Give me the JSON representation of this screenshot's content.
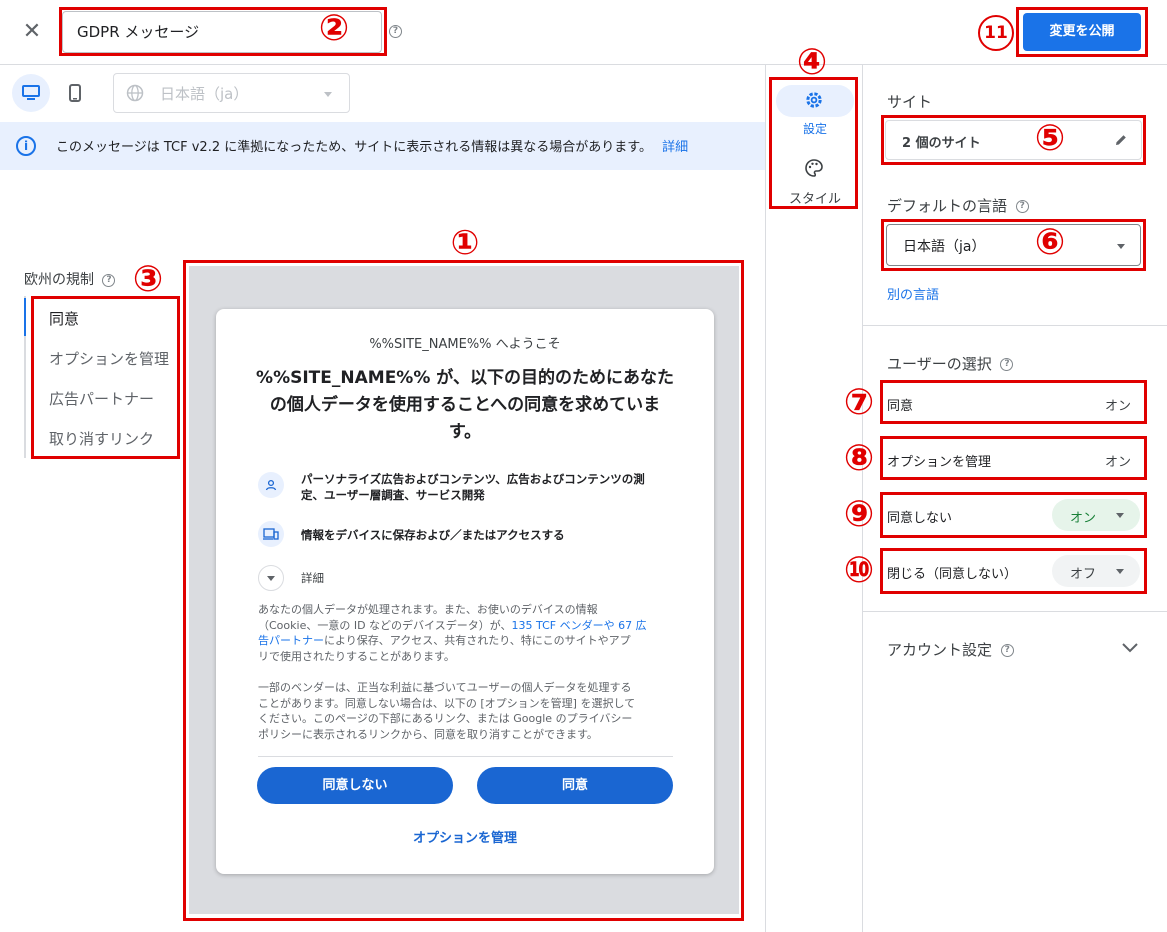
{
  "header": {
    "close_icon": "close-icon",
    "message_name": "GDPR メッセージ",
    "help_glyph": "?",
    "publish_label": "変更を公開"
  },
  "toolbar": {
    "language_placeholder": "日本語（ja）"
  },
  "info_bar": {
    "text": "このメッセージは TCF v2.2 に準拠になったため、サイトに表示される情報は異なる場合があります。",
    "link": "詳細"
  },
  "regulation": {
    "title": "欧州の規制",
    "items": [
      {
        "label": "同意"
      },
      {
        "label": "オプションを管理"
      },
      {
        "label": "広告パートナー"
      },
      {
        "label": "取り消すリンク"
      }
    ]
  },
  "preview": {
    "welcome": "%%SITE_NAME%% へようこそ",
    "headline_l1": "%%SITE_NAME%% が、以下の目的のためにあなた",
    "headline_l2": "の個人データを使用することへの同意を求めていま",
    "headline_l3": "す。",
    "purpose1_l1": "パーソナライズ広告およびコンテンツ、広告およびコンテンツの測",
    "purpose1_l2": "定、ユーザー層調査、サービス開発",
    "purpose2": "情報をデバイスに保存および／またはアクセスする",
    "details": "詳細",
    "para1_l1": "あなたの個人データが処理されます。また、お使いのデバイスの情報",
    "para1_l2_a": "（Cookie、一意の ID などのデバイスデータ）が、",
    "para1_l2_link": "135 TCF ベンダーや 67 広",
    "para1_l3_link": "告パートナー",
    "para1_l3_b": "により保存、アクセス、共有されたり、特にこのサイトやアプ",
    "para1_l4": "リで使用されたりすることがあります。",
    "para2_l1": "一部のベンダーは、正当な利益に基づいてユーザーの個人データを処理する",
    "para2_l2": "ことがあります。同意しない場合は、以下の [オプションを管理] を選択して",
    "para2_l3": "ください。このページの下部にあるリンク、または Google のプライバシー",
    "para2_l4": "ポリシーに表示されるリンクから、同意を取り消すことができます。",
    "decline_button": "同意しない",
    "accept_button": "同意",
    "manage_link": "オプションを管理"
  },
  "rail": {
    "settings_label": "設定",
    "style_label": "スタイル"
  },
  "right_panel": {
    "site_title": "サイト",
    "site_value": "2 個のサイト",
    "default_lang_title": "デフォルトの言語",
    "default_lang_value": "日本語（ja）",
    "other_lang_link": "別の言語",
    "user_choice_title": "ユーザーの選択",
    "choices": [
      {
        "label": "同意",
        "value": "オン"
      },
      {
        "label": "オプションを管理",
        "value": "オン"
      },
      {
        "label": "同意しない",
        "value": "オン"
      },
      {
        "label": "閉じる（同意しない）",
        "value": "オフ"
      }
    ],
    "account_title": "アカウント設定"
  },
  "annotations": [
    "①",
    "②",
    "③",
    "④",
    "⑤",
    "⑥",
    "⑦",
    "⑧",
    "⑨",
    "⑩",
    "11"
  ],
  "colors": {
    "accent": "#1a73e8",
    "annotation_red": "#e00000",
    "on_pill": "#e6f4ea",
    "on_text": "#188038",
    "off_pill": "#f1f3f4"
  }
}
